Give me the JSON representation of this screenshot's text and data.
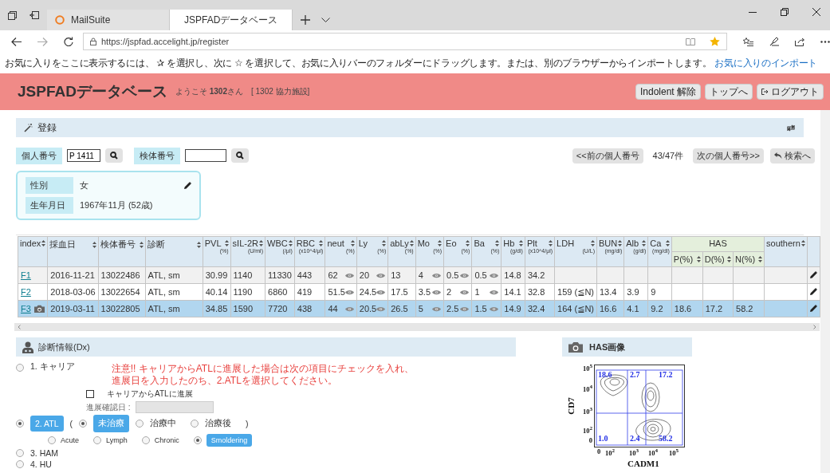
{
  "browser": {
    "tabs": [
      {
        "title": "MailSuite",
        "selected": false
      },
      {
        "title": "JSPFADデータベース",
        "selected": true
      }
    ],
    "url": "https://jspfad.accelight.jp/register",
    "favorites_hint": "お気に入りをここに表示するには、 ✰ を選択し、次に ☆ を選択して、お気に入りバーのフォルダーにドラッグします。または、別のブラウザーからインポートします。",
    "favorites_link": "お気に入りのインポート"
  },
  "header": {
    "title": "JSPFADデータベース",
    "welcome": "ようこそ **1302**さん",
    "facility": "[ 1302 協力施設]",
    "buttons": [
      {
        "label": "Indolent 解除",
        "kind": "plain"
      },
      {
        "label": "トップへ",
        "kind": "plain"
      },
      {
        "label": "ログアウト",
        "kind": "logout"
      }
    ]
  },
  "register": {
    "title": "登録",
    "search": [
      {
        "label": "個人番号",
        "value": "P 1411"
      },
      {
        "label": "検体番号"
      }
    ],
    "prev_button": "<<前の個人番号",
    "count": "43/47件",
    "next_button": "次の個人番号>>",
    "back_button": "検索へ",
    "profile": [
      {
        "label": "性別",
        "value": "女"
      },
      {
        "label": "生年月日",
        "value": "1967年11月 (52歳)"
      }
    ]
  },
  "table": {
    "columns": [
      {
        "label": "index"
      },
      {
        "label": "採血日"
      },
      {
        "label": "検体番号"
      },
      {
        "label": "診断"
      },
      {
        "label": "PVL",
        "unit": "(%)"
      },
      {
        "label": "sIL-2R",
        "unit": "(U/ml)"
      },
      {
        "label": "WBC",
        "unit": "(/μl)"
      },
      {
        "label": "RBC",
        "unit": "(x10^4/μl)"
      },
      {
        "label": "neut",
        "unit": "(%)",
        "eye": true
      },
      {
        "label": "Ly",
        "unit": "(%)",
        "eye": true
      },
      {
        "label": "abLy",
        "unit": "(%)"
      },
      {
        "label": "Mo",
        "unit": "(%)",
        "eye": true
      },
      {
        "label": "Eo",
        "unit": "(%)",
        "eye": true
      },
      {
        "label": "Ba",
        "unit": "(%)",
        "eye": true
      },
      {
        "label": "Hb",
        "unit": "(g/dl)"
      },
      {
        "label": "Plt",
        "unit": "(x10^4/μl)"
      },
      {
        "label": "LDH",
        "unit": "(U/L)"
      },
      {
        "label": "BUN",
        "unit": "(mg/dl)"
      },
      {
        "label": "Alb",
        "unit": "(g/dl)"
      },
      {
        "label": "Ca",
        "unit": "(mg/dl)"
      },
      {
        "label": "HAS",
        "colspan": 3,
        "children": [
          {
            "label": "P(%)"
          },
          {
            "label": "D(%)"
          },
          {
            "label": "N(%)"
          }
        ]
      },
      {
        "label": "southern"
      }
    ],
    "rows": [
      {
        "selected": false,
        "photo": false,
        "cells": [
          "F1",
          "2016-11-21",
          "13022486",
          "ATL, sm",
          "30.99",
          "1140",
          "11330",
          "443",
          "62",
          "20",
          "13",
          "4",
          "0.5",
          "0.5",
          "14.8",
          "34.2",
          null,
          null,
          null,
          null,
          null,
          null,
          null,
          null
        ]
      },
      {
        "selected": false,
        "photo": false,
        "cells": [
          "F2",
          "2018-03-06",
          "13022654",
          "ATL, sm",
          "40.14",
          "1190",
          "6860",
          "419",
          "51.5",
          "24.5",
          "17.5",
          "3.5",
          "2",
          "1",
          "14.1",
          "32.8",
          "159 (≦N)",
          "13.4",
          "3.9",
          "9",
          null,
          null,
          null,
          null
        ]
      },
      {
        "selected": true,
        "photo": true,
        "cells": [
          "F3",
          "2019-03-11",
          "13022805",
          "ATL, sm",
          "34.85",
          "1590",
          "7720",
          "438",
          "44",
          "20.5",
          "26.5",
          "5",
          "2.5",
          "1.5",
          "14.9",
          "32.4",
          "164 (≦N)",
          "16.6",
          "4.1",
          "9.2",
          "18.6",
          "17.2",
          "58.2",
          null
        ]
      }
    ]
  },
  "dx": {
    "title": "診断情報(Dx)",
    "options": [
      {
        "label": "1. キャリア",
        "selected": false,
        "note": [
          "注意!! キャリアからATLに進展した場合は次の項目にチェックを入れ、",
          "進展日を入力したのち、2.ATLを選択してください。"
        ],
        "progress": {
          "label": "キャリアからATLに進展",
          "checked": false
        },
        "progress_date": {
          "label": "進展確認日 :"
        }
      },
      {
        "label": "2. ATL",
        "selected": true,
        "treatment": {
          "open": "(",
          "close": ")",
          "options": [
            {
              "label": "未治療",
              "selected": true
            },
            {
              "label": "治療中",
              "selected": false
            },
            {
              "label": "治療後",
              "selected": false
            }
          ]
        },
        "subtypes": [
          {
            "label": "Acute",
            "selected": false
          },
          {
            "label": "Lymph",
            "selected": false
          },
          {
            "label": "Chronic",
            "selected": false
          },
          {
            "label": "Smoldering",
            "selected": true
          }
        ]
      },
      {
        "label": "3. HAM",
        "selected": false
      },
      {
        "label": "4. HU",
        "selected": false
      }
    ]
  },
  "has_image": {
    "title": "HAS画像",
    "plot": {
      "ylabel": "CD7",
      "xlabel": "CADM1",
      "yticks": [
        "10$^{5}$",
        "10$^{4}$",
        "10$^{3}$",
        "10$^{2}$",
        "0"
      ],
      "xticks": [
        "0",
        "10$^{2}$",
        "10$^{3}$",
        "10$^{4}$",
        "10$^{5}$"
      ],
      "gates": [
        "18.6",
        "2.7",
        "17.2",
        "1.0",
        "2.4",
        "58.2"
      ]
    }
  }
}
